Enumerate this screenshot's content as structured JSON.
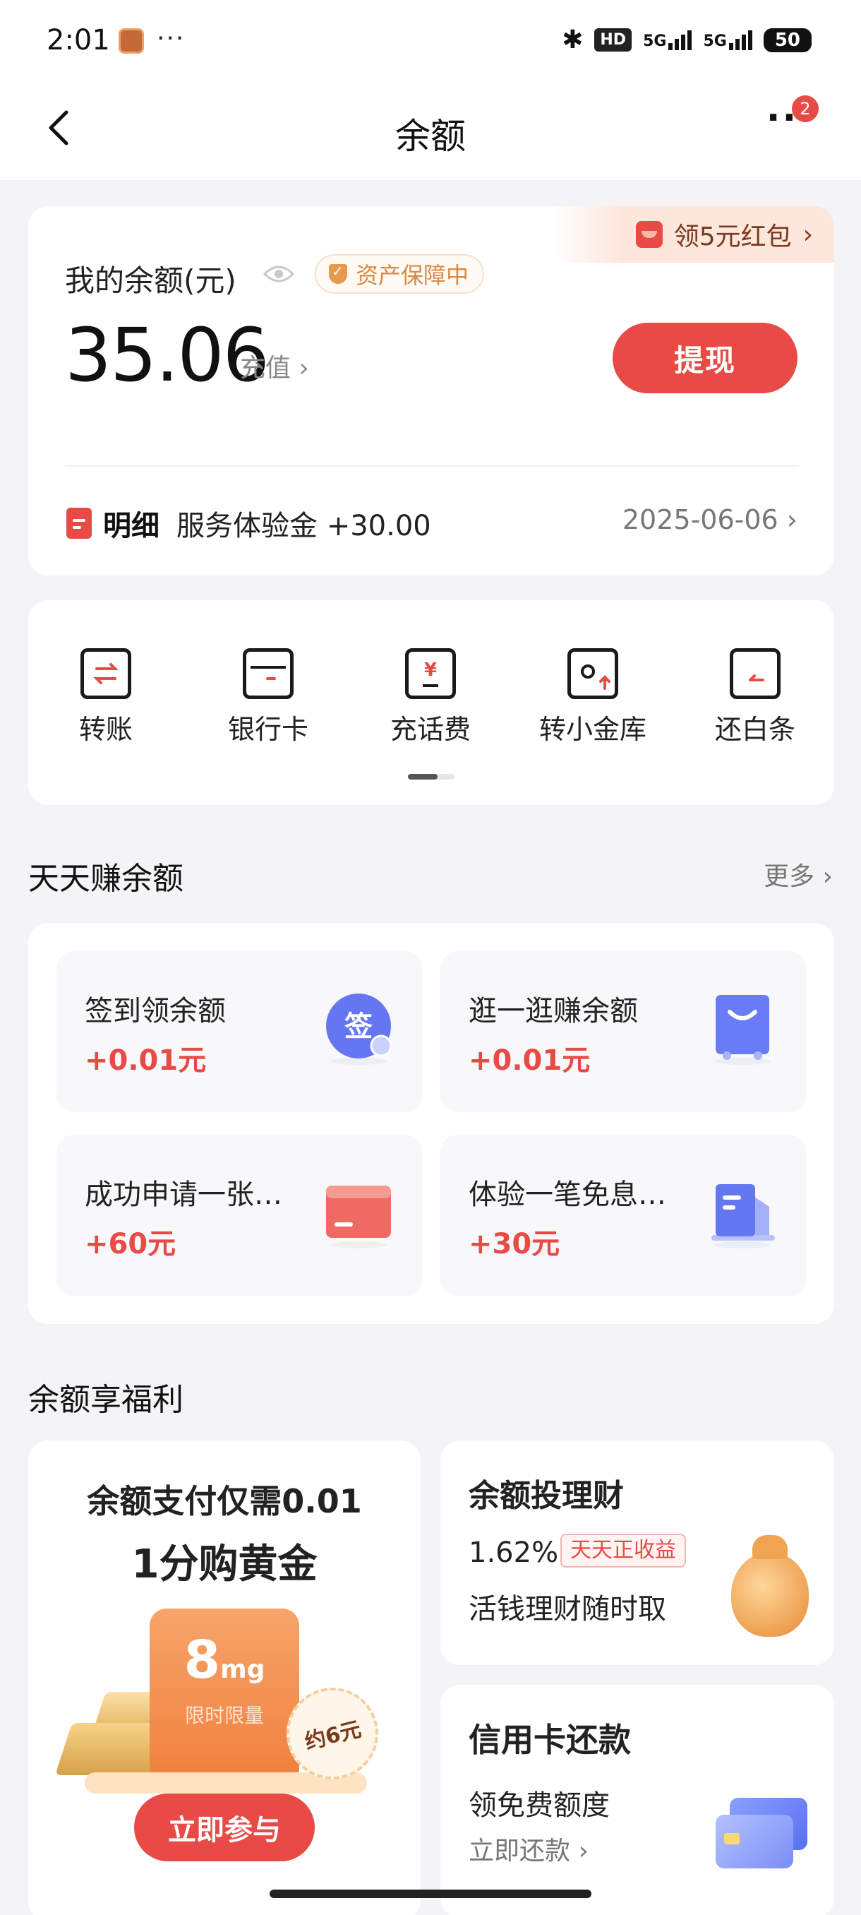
{
  "status_bar": {
    "time": "2:01",
    "dots": "···",
    "bluetooth": "✱",
    "hd": "HD",
    "signal1": "5G",
    "signal2": "5G",
    "battery": "50"
  },
  "nav": {
    "title": "余额",
    "more": "···",
    "badge": "2"
  },
  "balance": {
    "promo": "领5元红包",
    "label": "我的余额(元)",
    "protect": "资产保障中",
    "amount": "35.06",
    "recharge": "充值",
    "withdraw": "提现",
    "detail_label": "明细",
    "detail_text": "服务体验金 +30.00",
    "detail_date": "2025-06-06"
  },
  "quick_actions": [
    {
      "label": "转账",
      "icon": "transfer-icon"
    },
    {
      "label": "银行卡",
      "icon": "bank-card-icon"
    },
    {
      "label": "充话费",
      "icon": "phone-recharge-icon"
    },
    {
      "label": "转小金库",
      "icon": "vault-transfer-icon"
    },
    {
      "label": "还白条",
      "icon": "repay-icon"
    }
  ],
  "earn": {
    "title": "天天赚余额",
    "more": "更多",
    "items": [
      {
        "title": "签到领余额",
        "value": "+0.01元",
        "icon": "sign-in-icon",
        "icon_text": "签"
      },
      {
        "title": "逛一逛赚余额",
        "value": "+0.01元",
        "icon": "shopping-bag-icon"
      },
      {
        "title": "成功申请一张…",
        "value": "+60元",
        "icon": "card-icon"
      },
      {
        "title": "体验一笔免息…",
        "value": "+30元",
        "icon": "document-icon"
      }
    ]
  },
  "welfare": {
    "title": "余额享福利",
    "gold": {
      "line1": "余额支付仅需0.01",
      "line2": "1分购黄金",
      "amount": "8",
      "unit": "mg",
      "limit": "限时限量",
      "stamp": "约6元",
      "button": "立即参与"
    },
    "invest": {
      "title": "余额投理财",
      "rate": "1.62%",
      "tag": "天天正收益",
      "subtitle": "活钱理财随时取"
    },
    "credit": {
      "title": "信用卡还款",
      "subtitle": "领免费额度",
      "link": "立即还款"
    }
  },
  "colors": {
    "accent": "#e84a45",
    "background": "#f4f4f6"
  }
}
